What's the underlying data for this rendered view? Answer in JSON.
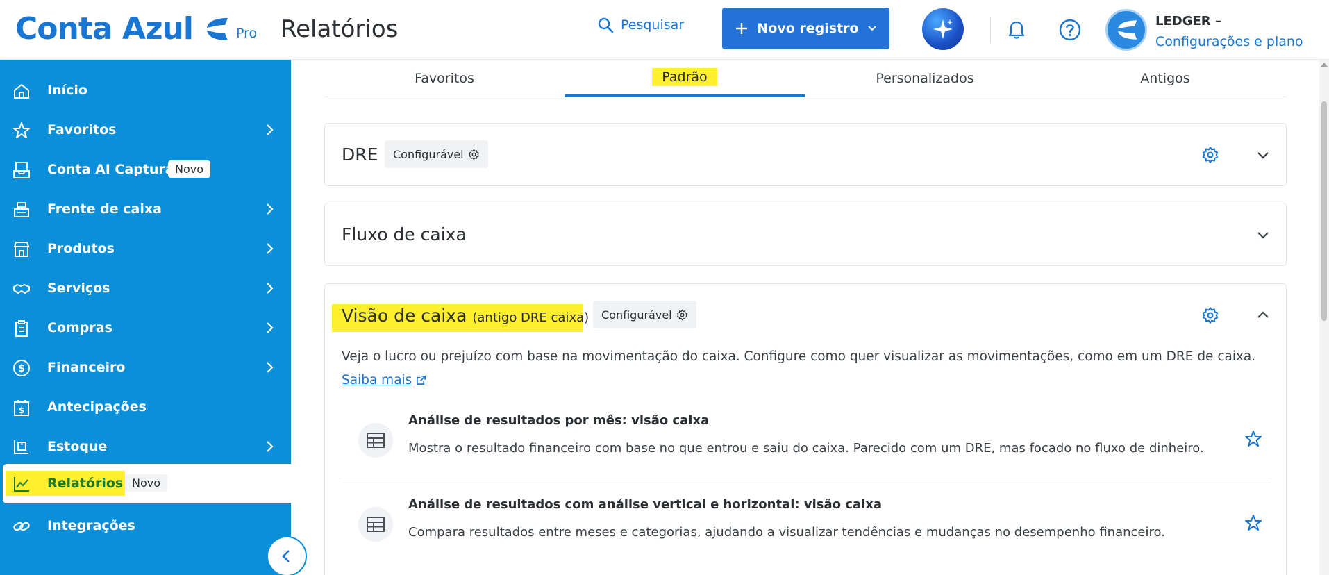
{
  "header": {
    "logo_text": "Conta Azul",
    "logo_plan": "Pro",
    "page_title": "Relatórios",
    "search_label": "Pesquisar",
    "new_record_label": "Novo registro",
    "account_name": "LEDGER –",
    "account_link": "Configurações e plano"
  },
  "sidebar": {
    "items": [
      {
        "label": "Início",
        "icon": "home-icon"
      },
      {
        "label": "Favoritos",
        "icon": "star-icon",
        "has_submenu": true
      },
      {
        "label": "Conta AI Captura",
        "icon": "inbox-icon",
        "badge": "Novo"
      },
      {
        "label": "Frente de caixa",
        "icon": "cash-register-icon",
        "has_submenu": true
      },
      {
        "label": "Produtos",
        "icon": "store-icon",
        "has_submenu": true
      },
      {
        "label": "Serviços",
        "icon": "handshake-icon",
        "has_submenu": true
      },
      {
        "label": "Compras",
        "icon": "clipboard-icon",
        "has_submenu": true
      },
      {
        "label": "Financeiro",
        "icon": "dollar-circle-icon",
        "has_submenu": true
      },
      {
        "label": "Antecipações",
        "icon": "calendar-dollar-icon"
      },
      {
        "label": "Estoque",
        "icon": "warehouse-icon",
        "has_submenu": true
      },
      {
        "label": "Relatórios",
        "icon": "line-chart-icon",
        "badge": "Novo",
        "active": true
      },
      {
        "label": "Integrações",
        "icon": "link-icon"
      }
    ]
  },
  "tabs": [
    {
      "label": "Favoritos"
    },
    {
      "label": "Padrão",
      "active": true
    },
    {
      "label": "Personalizados"
    },
    {
      "label": "Antigos"
    }
  ],
  "cards": {
    "dre": {
      "title": "DRE",
      "badge": "Configurável"
    },
    "fluxo": {
      "title": "Fluxo de caixa"
    },
    "visao": {
      "title": "Visão de caixa",
      "title_suffix": "(antigo DRE caixa)",
      "badge": "Configurável",
      "description": "Veja o lucro ou prejuízo com base na movimentação do caixa. Configure como quer visualizar as movimentações, como em um DRE de caixa.",
      "learn_more": "Saiba mais",
      "reports": [
        {
          "title": "Análise de resultados por mês: visão caixa",
          "description": "Mostra o resultado financeiro com base no que entrou e saiu do caixa. Parecido com um DRE, mas focado no fluxo de dinheiro."
        },
        {
          "title": "Análise de resultados com análise vertical e horizontal: visão caixa",
          "description": "Compara resultados entre meses e categorias, ajudando a visualizar tendências e mudanças no desempenho financeiro."
        }
      ]
    }
  },
  "colors": {
    "brand_blue": "#1976d2",
    "sidebar_blue": "#0a8fd8",
    "highlight_yellow": "#ffef2e"
  }
}
